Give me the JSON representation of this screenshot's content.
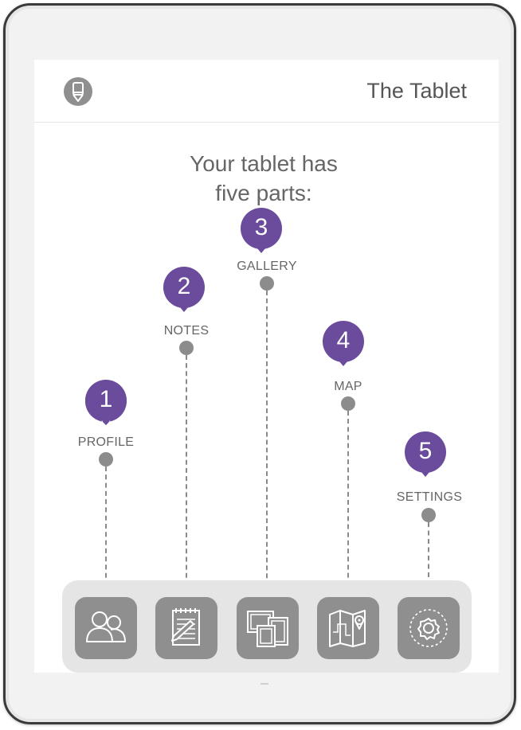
{
  "header": {
    "title": "The Tablet",
    "app_icon": "pencil-icon"
  },
  "intro": {
    "line1": "Your tablet has",
    "line2": "five parts:"
  },
  "parts": [
    {
      "number": "1",
      "label": "PROFILE",
      "icon": "profile-icon"
    },
    {
      "number": "2",
      "label": "NOTES",
      "icon": "notes-icon"
    },
    {
      "number": "3",
      "label": "GALLERY",
      "icon": "gallery-icon"
    },
    {
      "number": "4",
      "label": "MAP",
      "icon": "map-icon"
    },
    {
      "number": "5",
      "label": "SETTINGS",
      "icon": "settings-icon"
    }
  ],
  "colors": {
    "pin": "#6a4b9c",
    "button": "#8f8f8f",
    "tray": "#e5e5e5"
  }
}
